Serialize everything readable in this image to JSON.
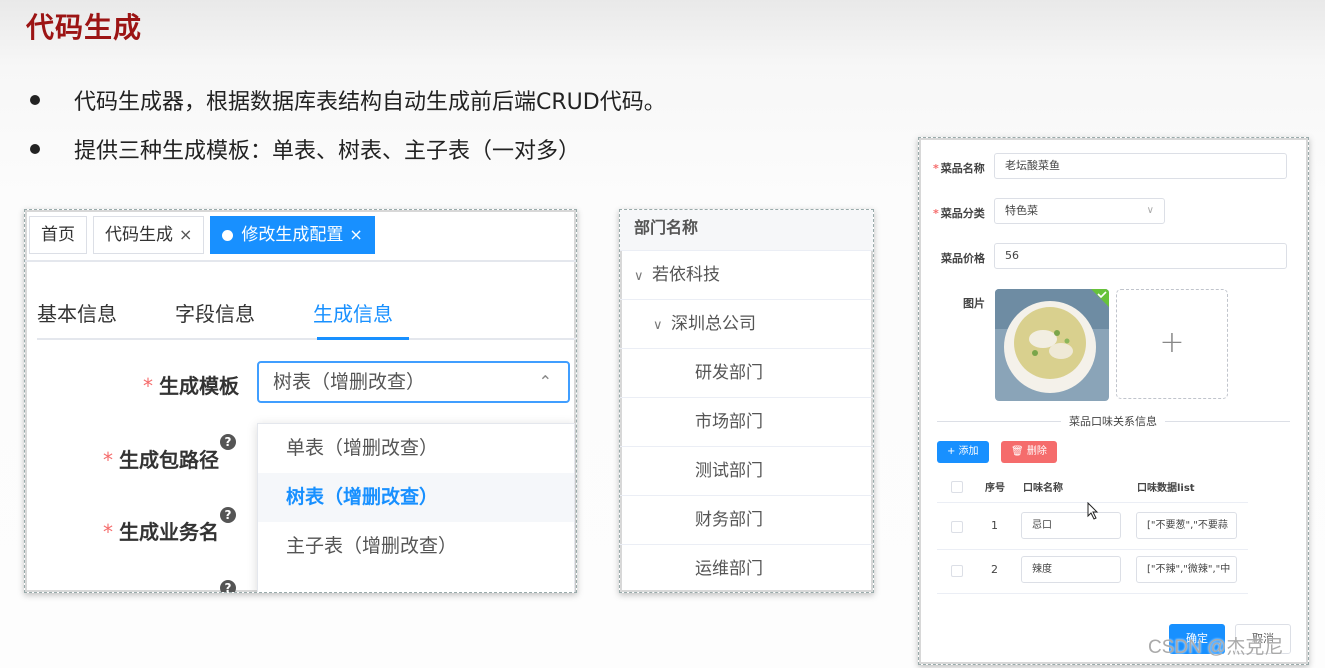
{
  "slide": {
    "title": "代码生成",
    "bullets": [
      "代码生成器，根据数据库表结构自动生成前后端CRUD代码。",
      "提供三种生成模板：单表、树表、主子表（一对多）"
    ]
  },
  "gen_config": {
    "tabs": [
      {
        "label": "首页"
      },
      {
        "label": "代码生成",
        "close": "×"
      },
      {
        "label": "修改生成配置",
        "close": "×"
      }
    ],
    "subtabs": [
      "基本信息",
      "字段信息",
      "生成信息"
    ],
    "active_subtab": "生成信息",
    "fields": {
      "template_label": "生成模板",
      "package_label": "生成包路径",
      "business_label": "生成业务名",
      "required_mark": "*",
      "help_icon": "?"
    },
    "template_value": "树表（增删改查）",
    "template_options": [
      "单表（增删改查）",
      "树表（增删改查）",
      "主子表（增删改查）"
    ],
    "selected_option": "树表（增删改查）"
  },
  "dept_tree": {
    "header": "部门名称",
    "nodes": [
      {
        "label": "若依科技",
        "level": 0,
        "expanded": true
      },
      {
        "label": "深圳总公司",
        "level": 1,
        "expanded": true
      },
      {
        "label": "研发部门",
        "level": 2
      },
      {
        "label": "市场部门",
        "level": 2
      },
      {
        "label": "测试部门",
        "level": 2
      },
      {
        "label": "财务部门",
        "level": 2
      },
      {
        "label": "运维部门",
        "level": 2
      }
    ]
  },
  "dish_form": {
    "name_label": "菜品名称",
    "name_value": "老坛酸菜鱼",
    "category_label": "菜品分类",
    "category_value": "特色菜",
    "price_label": "菜品价格",
    "price_value": "56",
    "image_label": "图片",
    "upload_plus": "+",
    "section_title": "菜品口味关系信息",
    "add_button": "+ 添加",
    "delete_button": "删除",
    "table_headers": [
      "序号",
      "口味名称",
      "口味数据list"
    ],
    "rows": [
      {
        "index": "1",
        "name": "忌口",
        "data": "[\"不要葱\",\"不要蒜"
      },
      {
        "index": "2",
        "name": "辣度",
        "data": "[\"不辣\",\"微辣\",\"中"
      }
    ],
    "confirm_button": "确定",
    "cancel_button": "取消"
  },
  "watermark": "CSDN @杰克尼",
  "colors": {
    "title": "#9c1414",
    "primary": "#1890ff",
    "danger": "#f56c6c"
  }
}
